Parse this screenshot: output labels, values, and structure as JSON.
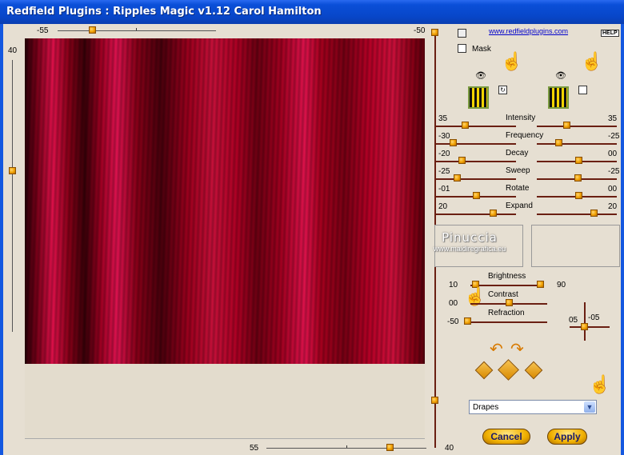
{
  "window": {
    "title": "Redfield Plugins : Ripples Magic v1.12   Carol Hamilton"
  },
  "top_slider": {
    "value": "-55",
    "fraction": 0.22
  },
  "left_slider": {
    "value": "40",
    "fraction": 0.45
  },
  "right_v_slider": {
    "top_value": "-50",
    "bottom_value": "40"
  },
  "bottom_slider": {
    "value": "55",
    "fraction": 0.82
  },
  "link": {
    "text": "www.redfieldplugins.com"
  },
  "help": {
    "text": "HELP"
  },
  "mask": {
    "label": "Mask"
  },
  "params": [
    {
      "name": "Intensity",
      "left": "35",
      "right": "35"
    },
    {
      "name": "Frequency",
      "left": "-30",
      "right": "-25"
    },
    {
      "name": "Decay",
      "left": "-20",
      "right": "00"
    },
    {
      "name": "Sweep",
      "left": "-25",
      "right": "-25"
    },
    {
      "name": "Rotate",
      "left": "-01",
      "right": "00"
    },
    {
      "name": "Expand",
      "left": "20",
      "right": "20"
    }
  ],
  "watermark": {
    "title": "Pinuccia",
    "subtitle": "www.maidiregrafica.eu"
  },
  "brightness": {
    "label": "Brightness",
    "left": "10",
    "right": "90"
  },
  "contrast": {
    "label": "Contrast",
    "left": "00"
  },
  "refraction": {
    "label": "Refraction",
    "left": "-50"
  },
  "light_pos": {
    "x": "05",
    "y": "-05"
  },
  "style_select": {
    "value": "Drapes"
  },
  "buttons": {
    "cancel": "Cancel",
    "apply": "Apply"
  },
  "colors": {
    "titlebar": "#0a4fd8",
    "accent": "#f0a000",
    "curtain": "#c8103a"
  },
  "icons": [
    "eye-icon",
    "hand-pointer-icon",
    "refresh-icon",
    "arrow-curve-icon",
    "dice-icon",
    "dropdown-arrow-icon"
  ]
}
